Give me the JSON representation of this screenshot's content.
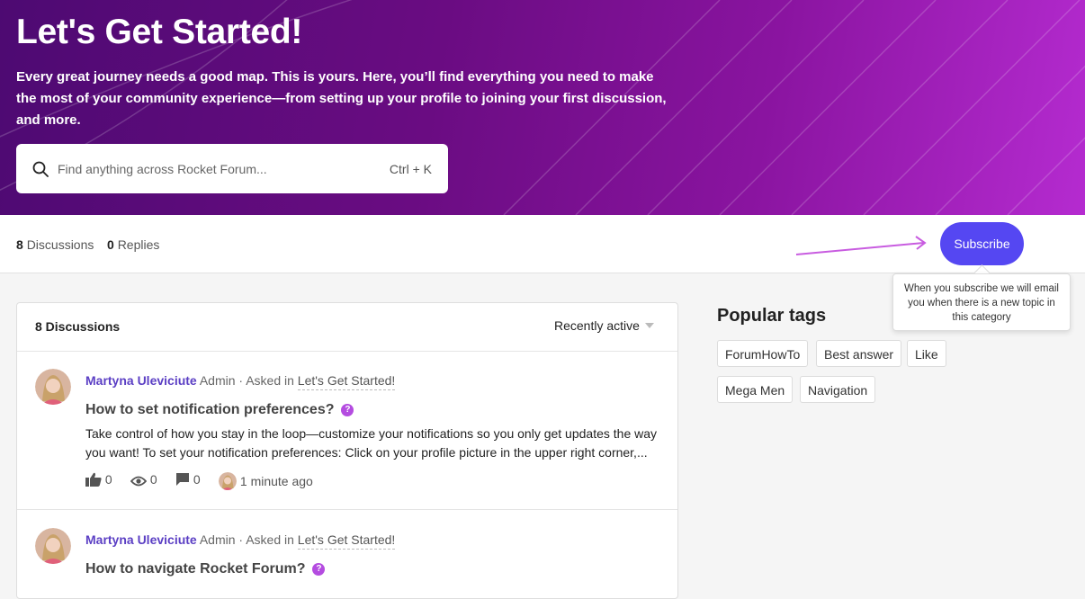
{
  "hero": {
    "title": "Let's Get Started!",
    "description": "Every great journey needs a good map. This is yours. Here, you’ll find everything you need to make the most of your community experience—from setting up your profile to joining your first discussion, and more.",
    "search": {
      "placeholder": "Find anything across Rocket Forum...",
      "shortcut": "Ctrl + K"
    }
  },
  "stats": {
    "discussions_count": "8",
    "discussions_label": "Discussions",
    "replies_count": "0",
    "replies_label": "Replies"
  },
  "subscribe": {
    "label": "Subscribe",
    "tooltip": "When you subscribe we will email you when there is a new topic in this category"
  },
  "discussions": {
    "header": "8 Discussions",
    "sort_label": "Recently active",
    "items": [
      {
        "author": "Martyna Uleviciute",
        "role": "Admin",
        "asked_in": "· Asked in",
        "category": "Let's Get Started!",
        "title": "How to set notification preferences?",
        "badge": "?",
        "excerpt": "Take control of how you stay in the loop—customize your notifications so you only get updates the way you want! To set your notification preferences: Click on your profile picture in the upper right corner,...",
        "likes": "0",
        "views": "0",
        "comments": "0",
        "time": "1 minute ago"
      },
      {
        "author": "Martyna Uleviciute",
        "role": "Admin",
        "asked_in": "· Asked in",
        "category": "Let's Get Started!",
        "title": "How to navigate Rocket Forum?",
        "badge": "?"
      }
    ]
  },
  "popular_tags": {
    "title": "Popular tags",
    "tags": [
      "ForumHowTo",
      "Best answer",
      "Like",
      "Mega Men",
      "Navigation"
    ]
  },
  "colors": {
    "accent": "#5547f2",
    "author": "#5b3fc4",
    "badge": "#b44ce0",
    "hero_start": "#4d0a72",
    "hero_end": "#b52bd0"
  }
}
